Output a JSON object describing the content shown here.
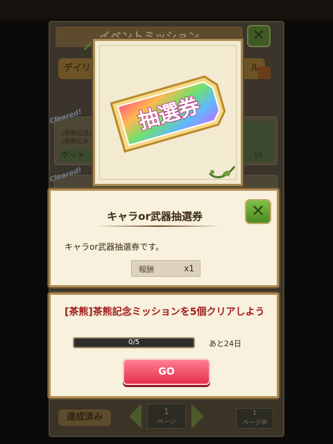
{
  "background": {
    "header_title": "イベントミッション",
    "tab_left": "デイリ",
    "tab_right": "ル",
    "rows": [
      {
        "cleared": "Cleared!",
        "line1": "[茶熊記念]",
        "line2": "[茶熊の木",
        "get": "ゲット",
        "reward": "10"
      },
      {
        "cleared": "Cleared!",
        "line1": "",
        "line2": "",
        "get": "",
        "reward": ""
      }
    ],
    "reward_label": "報酬",
    "done_button": "達成済み",
    "page_current": "1",
    "page_suffix": "ページ",
    "page_total": "1",
    "page_total_suffix": "ページ中"
  },
  "ticket": {
    "text": "抽選券"
  },
  "info": {
    "title": "キャラor武器抽選券",
    "description": "キャラor武器抽選券です。",
    "reward_label": "報酬",
    "reward_qty": "x1"
  },
  "mission": {
    "text": "[茶熊]茶熊記念ミッションを5個クリアしよう",
    "progress_text": "0/5",
    "progress_fraction": 0,
    "remaining": "あと24日",
    "go_label": "GO"
  },
  "colors": {
    "mission_text": "#a01d1d",
    "go_button": "#e5304c",
    "close_button": "#5fa832",
    "panel_bg": "#f8f1dd"
  },
  "icons": {
    "close": "close-x-icon",
    "vine": "vine-ornament-icon",
    "ticket": "lottery-ticket-icon"
  }
}
